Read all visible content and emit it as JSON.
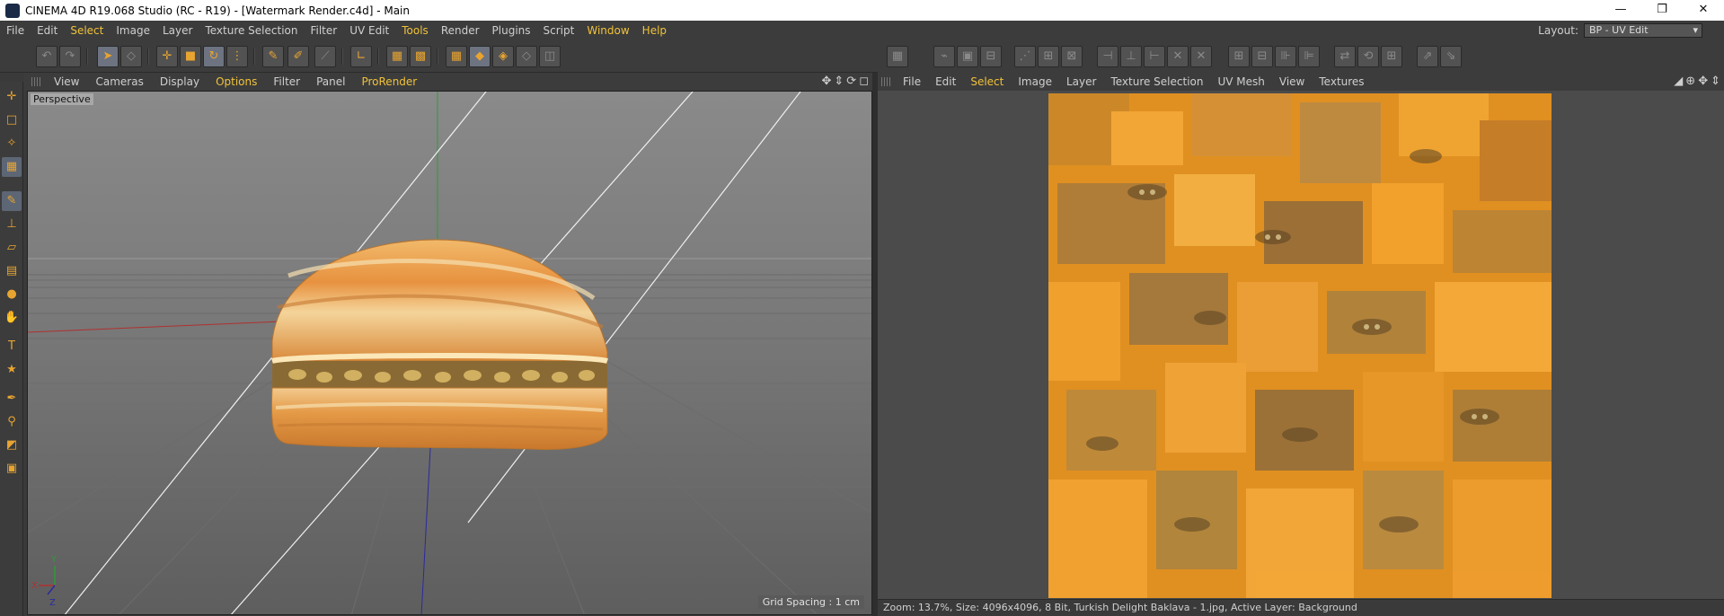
{
  "window": {
    "title": "CINEMA 4D R19.068 Studio (RC - R19) - [Watermark Render.c4d] - Main",
    "minimize": "—",
    "maximize": "❐",
    "close": "✕"
  },
  "menubar": {
    "items": [
      "File",
      "Edit",
      "Select",
      "Image",
      "Layer",
      "Texture Selection",
      "Filter",
      "UV Edit",
      "Tools",
      "Render",
      "Plugins",
      "Script",
      "Window",
      "Help"
    ],
    "highlighted": [
      "Select",
      "Tools",
      "Window",
      "Help"
    ],
    "layout_label": "Layout:",
    "layout_value": "BP - UV Edit"
  },
  "viewport": {
    "menu": [
      "View",
      "Cameras",
      "Display",
      "Options",
      "Filter",
      "Panel",
      "ProRender"
    ],
    "highlighted": [
      "Options",
      "ProRender"
    ],
    "label": "Perspective",
    "grid_spacing": "Grid Spacing : 1 cm",
    "axis_labels": [
      "Y",
      "X",
      "Z"
    ]
  },
  "uv_editor": {
    "menu": [
      "File",
      "Edit",
      "Select",
      "Image",
      "Layer",
      "Texture Selection",
      "UV Mesh",
      "View",
      "Textures"
    ],
    "highlighted": [
      "Select"
    ]
  },
  "status": {
    "text": "Zoom: 13.7%, Size: 4096x4096, 8 Bit, Turkish Delight Baklava - 1.jpg, Active Layer: Background"
  },
  "colors": {
    "accent": "#f0c23a",
    "icon_orange": "#e8a431",
    "texture_base": "#e2951f"
  }
}
